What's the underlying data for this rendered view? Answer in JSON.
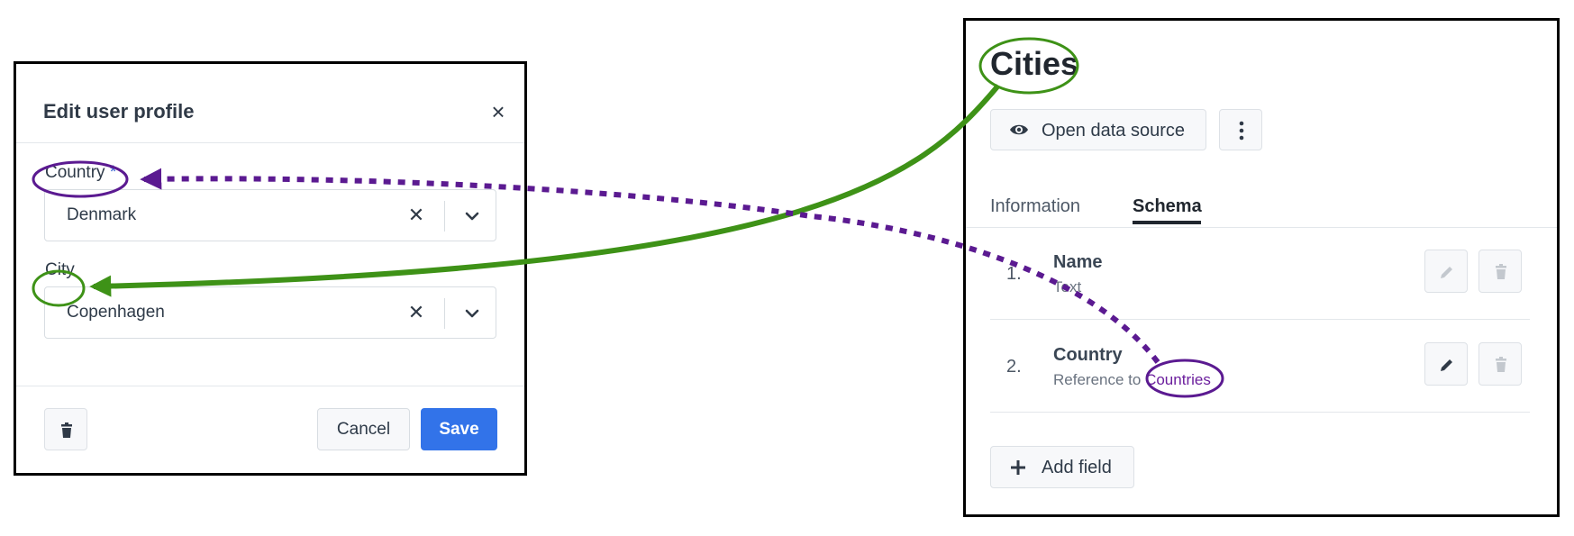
{
  "dialog": {
    "title": "Edit user profile",
    "country_label": "Country",
    "required_mark": "*",
    "country_value": "Denmark",
    "city_label": "City",
    "city_value": "Copenhagen",
    "cancel_label": "Cancel",
    "save_label": "Save"
  },
  "panel": {
    "title": "Cities",
    "open_data_source_label": "Open data source",
    "tabs": [
      {
        "label": "Information",
        "active": false
      },
      {
        "label": "Schema",
        "active": true
      }
    ],
    "fields": [
      {
        "number": "1.",
        "name": "Name",
        "type": "Text",
        "reference": ""
      },
      {
        "number": "2.",
        "name": "Country",
        "type": "Reference to",
        "reference": "Countries"
      }
    ],
    "add_field_label": "Add field"
  },
  "colors": {
    "green_arrow": "#3e9217",
    "purple_arrow": "#5b1a91",
    "primary": "#3273e9"
  }
}
